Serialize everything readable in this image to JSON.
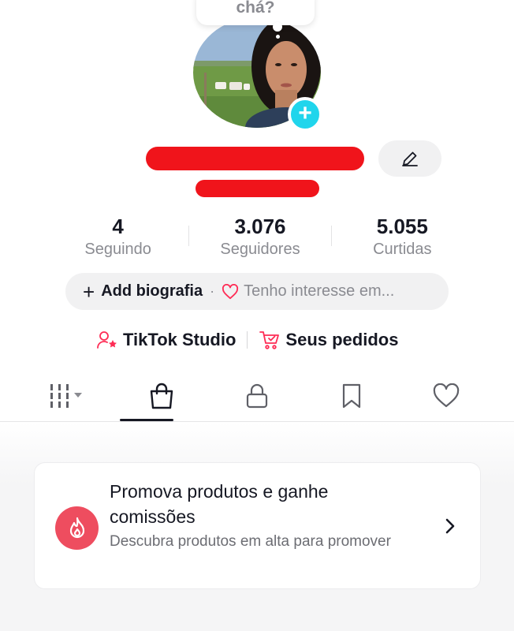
{
  "note": {
    "text": "chá?"
  },
  "profile": {
    "stats": [
      {
        "value": "4",
        "label": "Seguindo"
      },
      {
        "value": "3.076",
        "label": "Seguidores"
      },
      {
        "value": "5.055",
        "label": "Curtidas"
      }
    ],
    "bio": {
      "plus": "+",
      "add_label": "Add biografia",
      "separator": "·",
      "interest_label": "Tenho interesse em..."
    }
  },
  "links": {
    "studio": "TikTok Studio",
    "orders": "Seus pedidos"
  },
  "tabs": [
    {
      "icon": "grid-icon",
      "active": false
    },
    {
      "icon": "shopping-bag-icon",
      "active": true
    },
    {
      "icon": "lock-icon",
      "active": false
    },
    {
      "icon": "bookmark-icon",
      "active": false
    },
    {
      "icon": "heart-icon",
      "active": false
    }
  ],
  "promo": {
    "title": "Promova produtos e ganhe comissões",
    "subtitle": "Descubra produtos em alta para promover",
    "icon": "fire-icon"
  },
  "colors": {
    "accent_red": "#fe2c55",
    "add_blue": "#20d5ec",
    "promo_icon_bg": "#ee4d5f"
  }
}
